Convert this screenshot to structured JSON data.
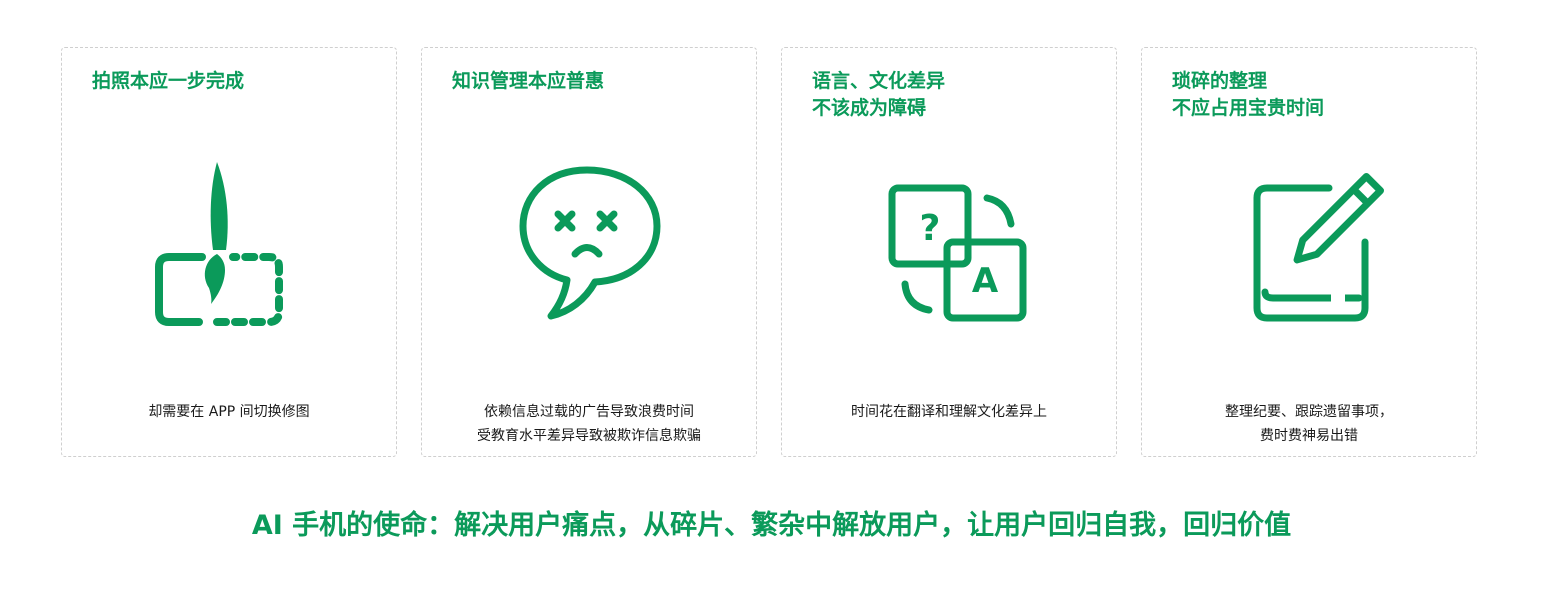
{
  "accent_color": "#0b9a5a",
  "cards": [
    {
      "title_lines": [
        "拍照本应一步完成"
      ],
      "icon": "brush-crop-icon",
      "desc_lines": [
        "却需要在 APP 间切换修图"
      ]
    },
    {
      "title_lines": [
        "知识管理本应普惠"
      ],
      "icon": "dizzy-speech-bubble-icon",
      "desc_lines": [
        "依赖信息过载的广告导致浪费时间",
        "受教育水平差异导致被欺诈信息欺骗"
      ]
    },
    {
      "title_lines": [
        "语言、文化差异",
        "不该成为障碍"
      ],
      "icon": "translate-icon",
      "desc_lines": [
        "时间花在翻译和理解文化差异上"
      ]
    },
    {
      "title_lines": [
        "琐碎的整理",
        "不应占用宝贵时间"
      ],
      "icon": "pen-notebook-icon",
      "desc_lines": [
        "整理纪要、跟踪遗留事项，",
        "费时费神易出错"
      ]
    }
  ],
  "mission": "AI 手机的使命：解决用户痛点，从碎片、繁杂中解放用户，让用户回归自我，回归价值"
}
